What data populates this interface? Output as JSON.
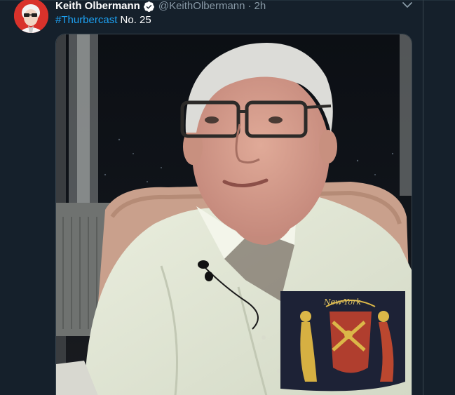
{
  "tweet": {
    "display_name": "Keith Olbermann",
    "handle": "@KeithOlbermann",
    "separator": "·",
    "time": "2h",
    "hashtag": "#Thurbercast",
    "text_rest": " No. 25",
    "verified_icon": "verified-badge-icon",
    "caret_icon": "chevron-down-icon"
  },
  "colors": {
    "background": "#15202b",
    "link": "#1da1f2",
    "secondary_text": "#8899a6",
    "border": "#38444d"
  }
}
